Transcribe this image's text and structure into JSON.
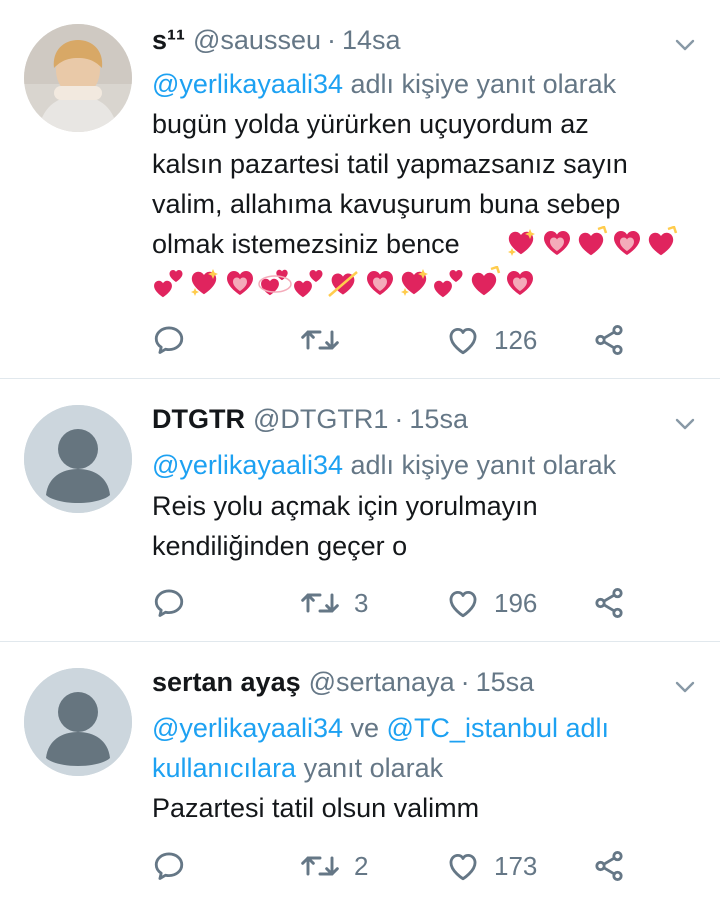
{
  "tweets": [
    {
      "name": "s¹¹",
      "handle": "@sausseu",
      "dot": "·",
      "time": "14sa",
      "reply_mention": "@yerlikayaali34",
      "reply_suffix": " adlı kişiye yanıt olarak",
      "body_lines": [
        "bugün yolda yürürken uçuyordum az",
        "kalsın pazartesi tatil yapmazsanız sayın",
        "valim, allahıma kavuşurum buna sebep",
        "olmak istemezsiniz bence"
      ],
      "emoji_line1": [
        "sparkling-heart",
        "heartbeat",
        "heart-ribbon",
        "heartbeat",
        "heart-ribbon"
      ],
      "emoji_line2": [
        "two-hearts",
        "sparkling-heart",
        "heartbeat",
        "revolving-hearts",
        "two-hearts",
        "heart-arrow",
        "heartbeat",
        "sparkling-heart",
        "two-hearts",
        "heart-ribbon",
        "heartbeat"
      ],
      "reply_count": "",
      "retweet_count": "",
      "like_count": "126"
    },
    {
      "name": "DTGTR",
      "handle": "@DTGTR1",
      "dot": "·",
      "time": "15sa",
      "reply_mention": "@yerlikayaali34",
      "reply_suffix": " adlı kişiye yanıt olarak",
      "body_lines": [
        "Reis yolu açmak için yorulmayın",
        "kendiliğinden geçer o"
      ],
      "reply_count": "",
      "retweet_count": "3",
      "like_count": "196"
    },
    {
      "name": "sertan ayaş",
      "handle": "@sertanaya",
      "dot": "·",
      "time": "15sa",
      "reply_line1_mention1": "@yerlikayaali34",
      "reply_line1_mid": " ve ",
      "reply_line1_mention2": "@TC_istanbul",
      "reply_line1_mention3": " adlı",
      "reply_line2_mention": "kullanıcılara",
      "reply_line2_suffix": " yanıt olarak",
      "body_lines": [
        "Pazartesi tatil olsun valimm"
      ],
      "reply_count": "",
      "retweet_count": "2",
      "like_count": "173"
    }
  ],
  "icons": {
    "reply": "reply-icon",
    "retweet": "retweet-icon",
    "like": "like-icon",
    "share": "share-icon",
    "caret": "chevron-down-icon"
  },
  "colors": {
    "link": "#1da1f2",
    "secondary": "#657786",
    "text": "#14171a",
    "heart": "#e0245e",
    "separator": "#e1e8ed"
  }
}
